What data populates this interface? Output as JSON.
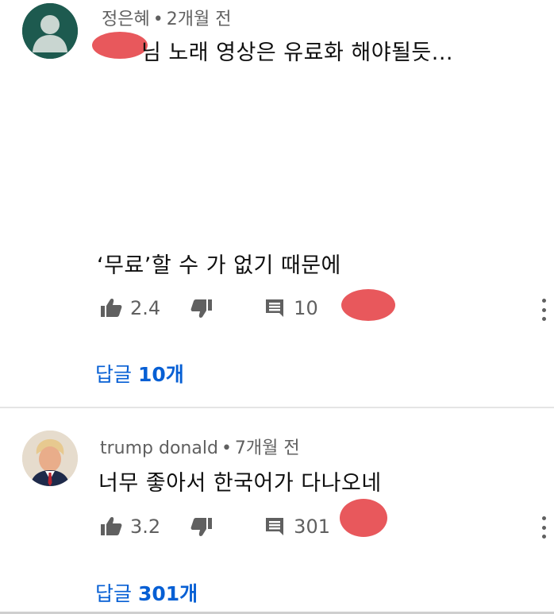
{
  "comments": [
    {
      "author": "정은혜",
      "separator": "•",
      "time": "2개월 전",
      "text_line1": "님 노래 영상은 유료화 해야될듯...",
      "text_line2": "‘무료’할 수 가 없기 때문에",
      "likes": "2.4",
      "reply_count": "10",
      "replies_label_prefix": "답글 ",
      "replies_label_count": "10개",
      "avatar_icon": "default-user-avatar"
    },
    {
      "author": "trump donald",
      "separator": "•",
      "time": "7개월 전",
      "text_line1": "너무 좋아서 한국어가 다나오네",
      "likes": "3.2",
      "reply_count": "301",
      "replies_label_prefix": "답글 ",
      "replies_label_count": "301개",
      "avatar_icon": "profile-photo"
    }
  ],
  "icons": {
    "like": "thumbs-up-icon",
    "dislike": "thumbs-down-icon",
    "reply": "comment-icon",
    "more": "more-vertical-icon"
  },
  "colors": {
    "link": "#065fd4",
    "meta": "#606060",
    "text": "#0f0f0f",
    "redaction": "#e8585c"
  }
}
